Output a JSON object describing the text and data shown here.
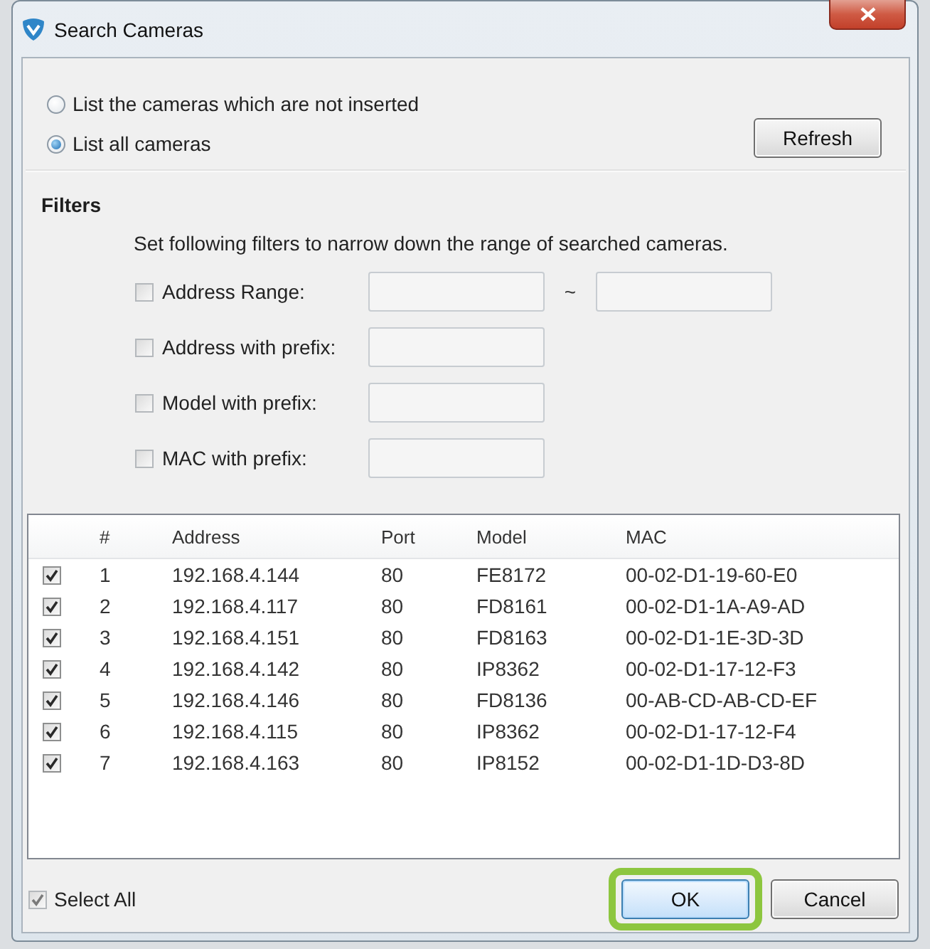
{
  "window": {
    "title": "Search Cameras"
  },
  "radios": [
    {
      "label": "List the cameras which are not inserted",
      "selected": false
    },
    {
      "label": "List all cameras",
      "selected": true
    }
  ],
  "refresh_button": "Refresh",
  "filters": {
    "title": "Filters",
    "description": "Set following filters to narrow down the range of searched cameras.",
    "items": [
      {
        "kind": "range",
        "label": "Address Range:",
        "checked": false,
        "separator": "~"
      },
      {
        "kind": "single",
        "label": "Address with prefix:",
        "checked": false
      },
      {
        "kind": "single",
        "label": "Model with prefix:",
        "checked": false
      },
      {
        "kind": "single",
        "label": "MAC with prefix:",
        "checked": false
      }
    ]
  },
  "table": {
    "columns": [
      "#",
      "Address",
      "Port",
      "Model",
      "MAC"
    ],
    "rows": [
      {
        "checked": true,
        "cells": [
          "1",
          "192.168.4.144",
          "80",
          "FE8172",
          "00-02-D1-19-60-E0"
        ]
      },
      {
        "checked": true,
        "cells": [
          "2",
          "192.168.4.117",
          "80",
          "FD8161",
          "00-02-D1-1A-A9-AD"
        ]
      },
      {
        "checked": true,
        "cells": [
          "3",
          "192.168.4.151",
          "80",
          "FD8163",
          "00-02-D1-1E-3D-3D"
        ]
      },
      {
        "checked": true,
        "cells": [
          "4",
          "192.168.4.142",
          "80",
          "IP8362",
          "00-02-D1-17-12-F3"
        ]
      },
      {
        "checked": true,
        "cells": [
          "5",
          "192.168.4.146",
          "80",
          "FD8136",
          "00-AB-CD-AB-CD-EF"
        ]
      },
      {
        "checked": true,
        "cells": [
          "6",
          "192.168.4.115",
          "80",
          "IP8362",
          "00-02-D1-17-12-F4"
        ]
      },
      {
        "checked": true,
        "cells": [
          "7",
          "192.168.4.163",
          "80",
          "IP8152",
          "00-02-D1-1D-D3-8D"
        ]
      }
    ]
  },
  "select_all": {
    "label": "Select All",
    "checked": true
  },
  "buttons": [
    {
      "label": "OK",
      "default": true,
      "highlighted": true
    },
    {
      "label": "Cancel",
      "default": false,
      "highlighted": false
    }
  ]
}
